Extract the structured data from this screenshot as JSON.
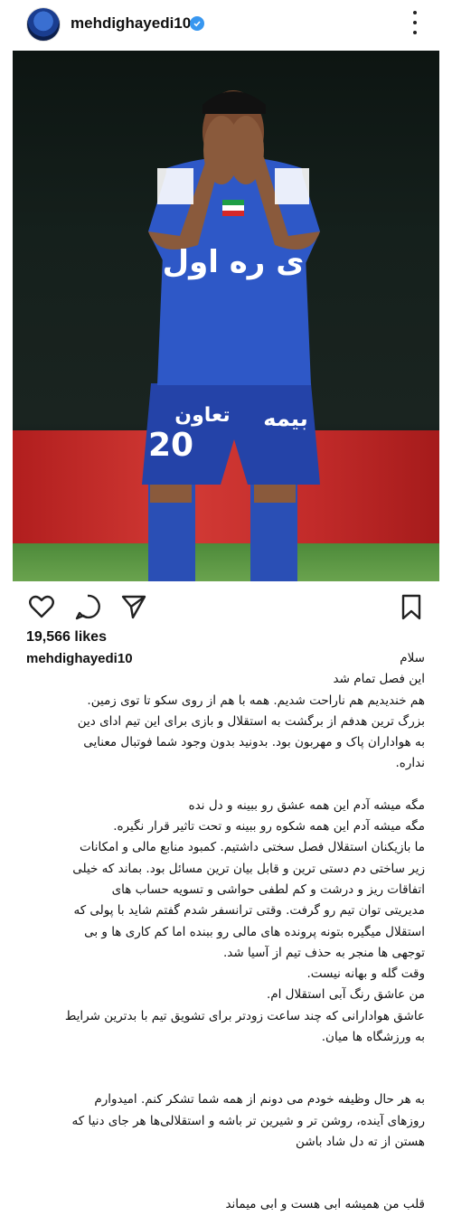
{
  "post": {
    "username": "mehdighayedi10",
    "likes": "19,566 likes"
  },
  "photo": {
    "jersey_number": "20",
    "jersey_text": "تعاون",
    "sponsor": "بیمه",
    "chest_logo": "ی ره اول"
  },
  "caption": {
    "lines": [
      "سلام",
      "این فصل تمام شد",
      "هم خندیدیم هم ناراحت شدیم. همه با هم از روی سکو تا توی زمین.",
      "بزرگ ترین هدفم از برگشت به استقلال و بازی برای این تیم  ادای دین",
      "به هواداران پاک و مهربون بود.  بدونید بدون وجود شما فوتبال معنایی",
      "نداره.",
      "",
      "مگه میشه آدم این همه عشق رو ببینه و دل نده",
      "مگه میشه آدم این همه شکوه رو ببینه و تحت تاثیر قرار نگیره.",
      "ما بازیکنان استقلال فصل سختی داشتیم. کمبود منابع مالی و امکانات",
      "زیر ساختی دم دستی ترین و قابل بیان ترین مسائل بود. بماند که خیلی",
      "اتفاقات ریز و درشت و کم لطفی  حواشی و تسویه حساب های",
      "مدیریتی توان تیم رو گرفت. وقتی ترانسفر شدم گفتم شاید با پولی که",
      "استقلال میگیره بتونه پرونده های مالی رو ببنده اما کم کاری ها و بی",
      "توجهی ها منجر به حذف تیم از آسیا شد.",
      "وقت گله و بهانه نیست.",
      "من عاشق رنگ آبی استقلال ام.",
      "عاشق هوادارانی که چند ساعت زودتر برای تشویق تیم با بدترین شرایط",
      "به ورزشگاه ها میان.",
      "",
      "",
      "به هر حال وظیفه خودم می دونم از همه شما تشکر کنم. امیدوارم",
      "روزهای آینده، روشن تر و شیرین تر باشه و استقلالی‌ها هر جای دنیا که",
      "هستن از ته دل شاد باشن",
      "",
      "",
      "قلب من همیشه ابی هست و ابی میماند"
    ]
  }
}
